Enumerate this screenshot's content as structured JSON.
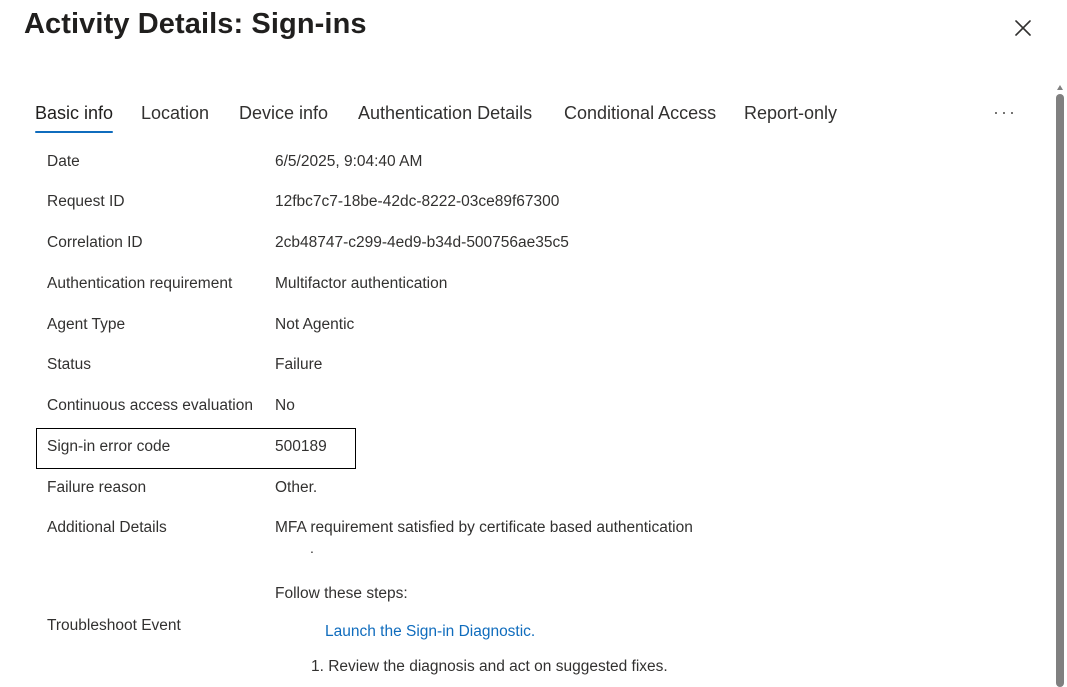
{
  "panel": {
    "title": "Activity Details: Sign-ins",
    "close_icon": "close-icon"
  },
  "tabs": [
    {
      "label": "Basic info",
      "active": true
    },
    {
      "label": "Location",
      "active": false
    },
    {
      "label": "Device info",
      "active": false
    },
    {
      "label": "Authentication Details",
      "active": false
    },
    {
      "label": "Conditional Access",
      "active": false
    },
    {
      "label": "Report-only",
      "active": false
    }
  ],
  "more_label": "···",
  "details": [
    {
      "label": "Date",
      "value": "6/5/2025, 9:04:40 AM"
    },
    {
      "label": "Request ID",
      "value": "12fbc7c7-18be-42dc-8222-03ce89f67300"
    },
    {
      "label": "Correlation ID",
      "value": "2cb48747-c299-4ed9-b34d-500756ae35c5"
    },
    {
      "label": "Authentication requirement",
      "value": "Multifactor authentication"
    },
    {
      "label": "Agent Type",
      "value": "Not Agentic"
    },
    {
      "label": "Status",
      "value": "Failure"
    },
    {
      "label": "Continuous access evaluation",
      "value": "No"
    },
    {
      "label": "Sign-in error code",
      "value": "500189"
    },
    {
      "label": "Failure reason",
      "value": "Other."
    },
    {
      "label": "Additional Details",
      "value": "MFA requirement satisfied by certificate based authentication"
    }
  ],
  "additional_dot": ".",
  "troubleshoot": {
    "label": "Troubleshoot Event",
    "steps_title": "Follow these steps:",
    "link": "Launch the Sign-in Diagnostic.",
    "step_1": "1. Review the diagnosis and act on suggested fixes."
  },
  "colors": {
    "accent": "#0f6cbd",
    "text": "#323130",
    "highlight_border": "#000000"
  }
}
